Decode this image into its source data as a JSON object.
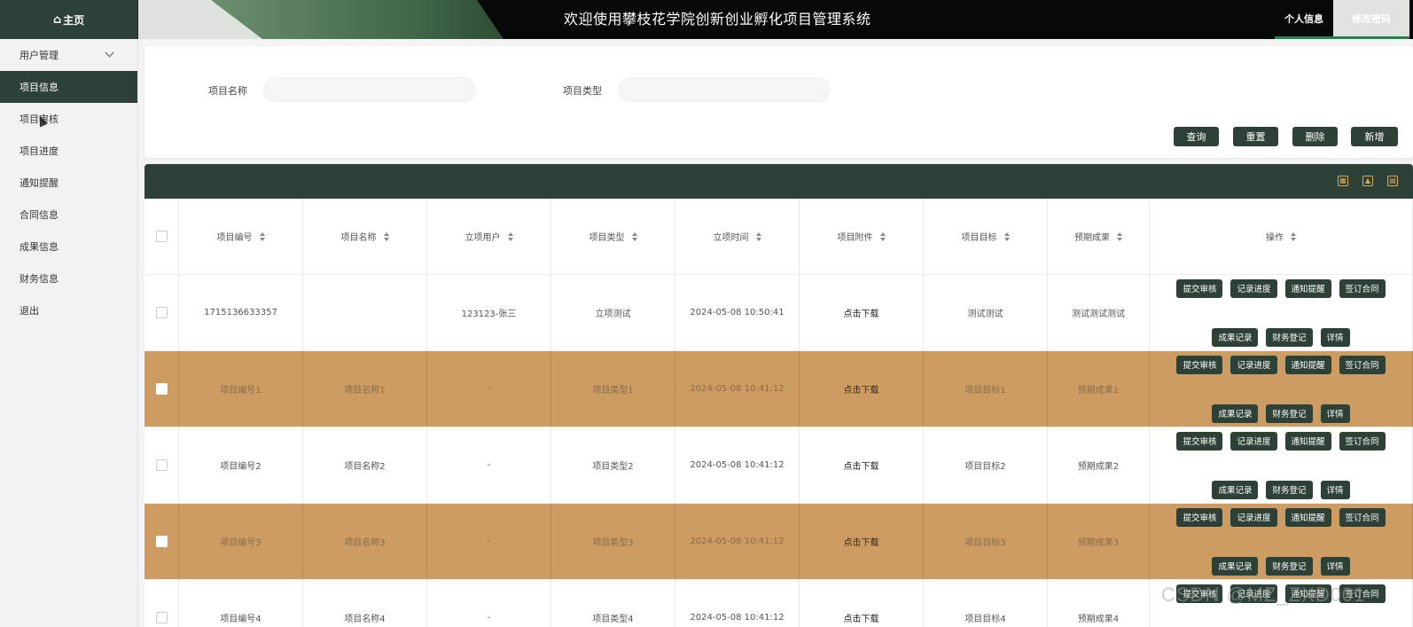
{
  "header": {
    "home_label": "主页",
    "home_icon": "home-icon",
    "title": "欢迎使用攀枝花学院创新创业孵化项目管理系统",
    "tab_personal": "个人信息",
    "tab_password": "修改密码"
  },
  "sidebar": {
    "items": [
      {
        "label": "用户管理"
      },
      {
        "label": "项目信息"
      },
      {
        "label": "项目审核"
      },
      {
        "label": "项目进度"
      },
      {
        "label": "通知提醒"
      },
      {
        "label": "合同信息"
      },
      {
        "label": "成果信息"
      },
      {
        "label": "财务信息"
      },
      {
        "label": "退出"
      }
    ]
  },
  "search": {
    "name_label": "项目名称",
    "name_value": "",
    "type_label": "项目类型",
    "type_value": "",
    "btn_query": "查询",
    "btn_reset": "重置",
    "btn_delete": "删除",
    "btn_add": "新增"
  },
  "table": {
    "columns": [
      "项目编号",
      "项目名称",
      "立项用户",
      "项目类型",
      "立项时间",
      "项目附件",
      "项目目标",
      "预期成果",
      "操作"
    ],
    "ops": [
      "提交审核",
      "记录进度",
      "通知提醒",
      "签订合同",
      "成果记录",
      "财务登记",
      "详情"
    ],
    "rows": [
      {
        "id": "1715136633357",
        "name": "",
        "user": "123123-张三",
        "type": "立项测试",
        "time": "2024-05-08 10:50:41",
        "attach": "点击下载",
        "goal": "测试测试",
        "result": "测试测试测试"
      },
      {
        "id": "项目编号1",
        "name": "项目名称1",
        "user": "-",
        "type": "项目类型1",
        "time": "2024-05-08 10:41:12",
        "attach": "点击下载",
        "goal": "项目目标1",
        "result": "预期成果1"
      },
      {
        "id": "项目编号2",
        "name": "项目名称2",
        "user": "-",
        "type": "项目类型2",
        "time": "2024-05-08 10:41:12",
        "attach": "点击下载",
        "goal": "项目目标2",
        "result": "预期成果2"
      },
      {
        "id": "项目编号3",
        "name": "项目名称3",
        "user": "-",
        "type": "项目类型3",
        "time": "2024-05-08 10:41:12",
        "attach": "点击下载",
        "goal": "项目目标3",
        "result": "预期成果3"
      },
      {
        "id": "项目编号4",
        "name": "项目名称4",
        "user": "-",
        "type": "项目类型4",
        "time": "2024-05-08 10:41:12",
        "attach": "点击下载",
        "goal": "项目目标4",
        "result": "预期成果4"
      }
    ]
  },
  "watermark": "CSDN @MZ_ZXD001",
  "colors": {
    "primary": "#2e4136",
    "row_alt": "#cc9c63",
    "accent_line": "#2e7d4e"
  }
}
